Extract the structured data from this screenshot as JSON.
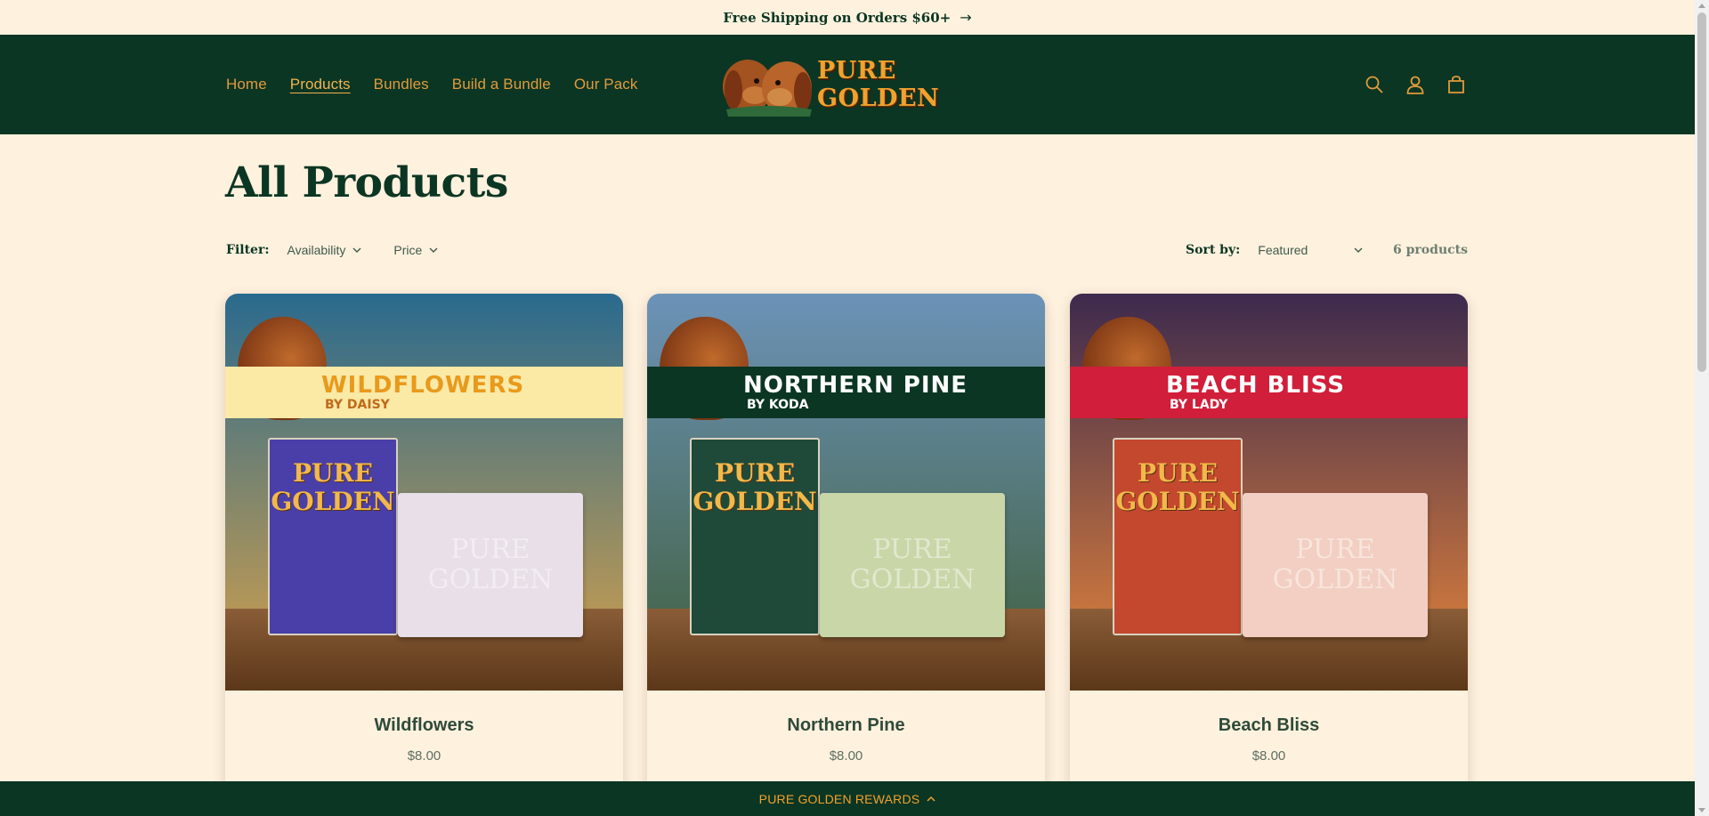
{
  "announcement": {
    "text": "Free Shipping on Orders $60+",
    "arrow": "→"
  },
  "header": {
    "nav": [
      {
        "label": "Home",
        "active": false
      },
      {
        "label": "Products",
        "active": true
      },
      {
        "label": "Bundles",
        "active": false
      },
      {
        "label": "Build a Bundle",
        "active": false
      },
      {
        "label": "Our Pack",
        "active": false
      }
    ],
    "logo_text": "PURE GOLDEN",
    "icons": [
      "search-icon",
      "account-icon",
      "cart-icon"
    ]
  },
  "page": {
    "title": "All Products"
  },
  "filters": {
    "label": "Filter:",
    "options": [
      "Availability",
      "Price"
    ],
    "sort_label": "Sort by:",
    "sort_value": "Featured",
    "count": "6 products"
  },
  "products": [
    {
      "name": "Wildflowers",
      "price": "$8.00",
      "banner_title": "WILDFLOWERS",
      "banner_sub": "BY DAISY",
      "box_line1": "PURE",
      "box_line2": "GOLDEN",
      "soap_line1": "PURE",
      "soap_line2": "GOLDEN",
      "colors": {
        "sky_top": "#2a6a8e",
        "sky_bottom": "#d7a24a",
        "banner": "#fbe9a6",
        "banner_text": "#e89a1c",
        "banner_sub": "#c06a1a",
        "box": "#4a3fa8",
        "soap": "#e8dfe8"
      }
    },
    {
      "name": "Northern Pine",
      "price": "$8.00",
      "banner_title": "NORTHERN PINE",
      "banner_sub": "BY KODA",
      "box_line1": "PURE",
      "box_line2": "GOLDEN",
      "soap_line1": "PURE",
      "soap_line2": "GOLDEN",
      "colors": {
        "sky_top": "#6c93b8",
        "sky_bottom": "#3f5e3a",
        "banner": "#0b3623",
        "banner_text": "#ffffff",
        "banner_sub": "#ffffff",
        "box": "#1f4a3a",
        "soap": "#c9d6a8"
      }
    },
    {
      "name": "Beach Bliss",
      "price": "$8.00",
      "banner_title": "BEACH BLISS",
      "banner_sub": "BY LADY",
      "box_line1": "PURE",
      "box_line2": "GOLDEN",
      "soap_line1": "PURE",
      "soap_line2": "GOLDEN",
      "colors": {
        "sky_top": "#3d2a4e",
        "sky_bottom": "#e9873a",
        "banner": "#d11e3a",
        "banner_text": "#ffffff",
        "banner_sub": "#ffffff",
        "box": "#c4482e",
        "soap": "#f2cfc2"
      }
    }
  ],
  "rewards": {
    "label": "PURE GOLDEN REWARDS"
  }
}
